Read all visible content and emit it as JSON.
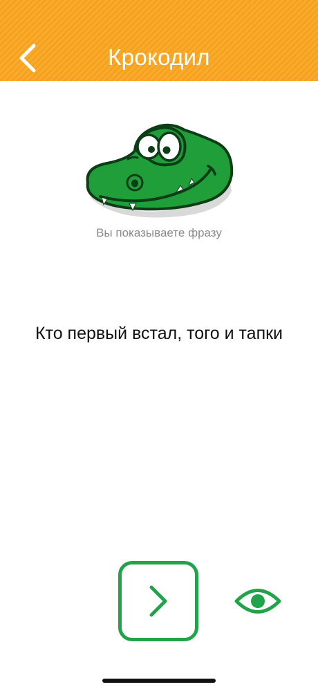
{
  "header": {
    "title": "Крокодил",
    "back_icon": "chevron-left-icon",
    "background_color": "#f9a51e"
  },
  "mascot": {
    "icon": "crocodile-logo"
  },
  "main": {
    "subtitle": "Вы показываете фразу",
    "phrase": "Кто первый встал, того и тапки"
  },
  "controls": {
    "next_icon": "chevron-right-icon",
    "reveal_icon": "eye-icon",
    "accent_color": "#21a34a"
  }
}
